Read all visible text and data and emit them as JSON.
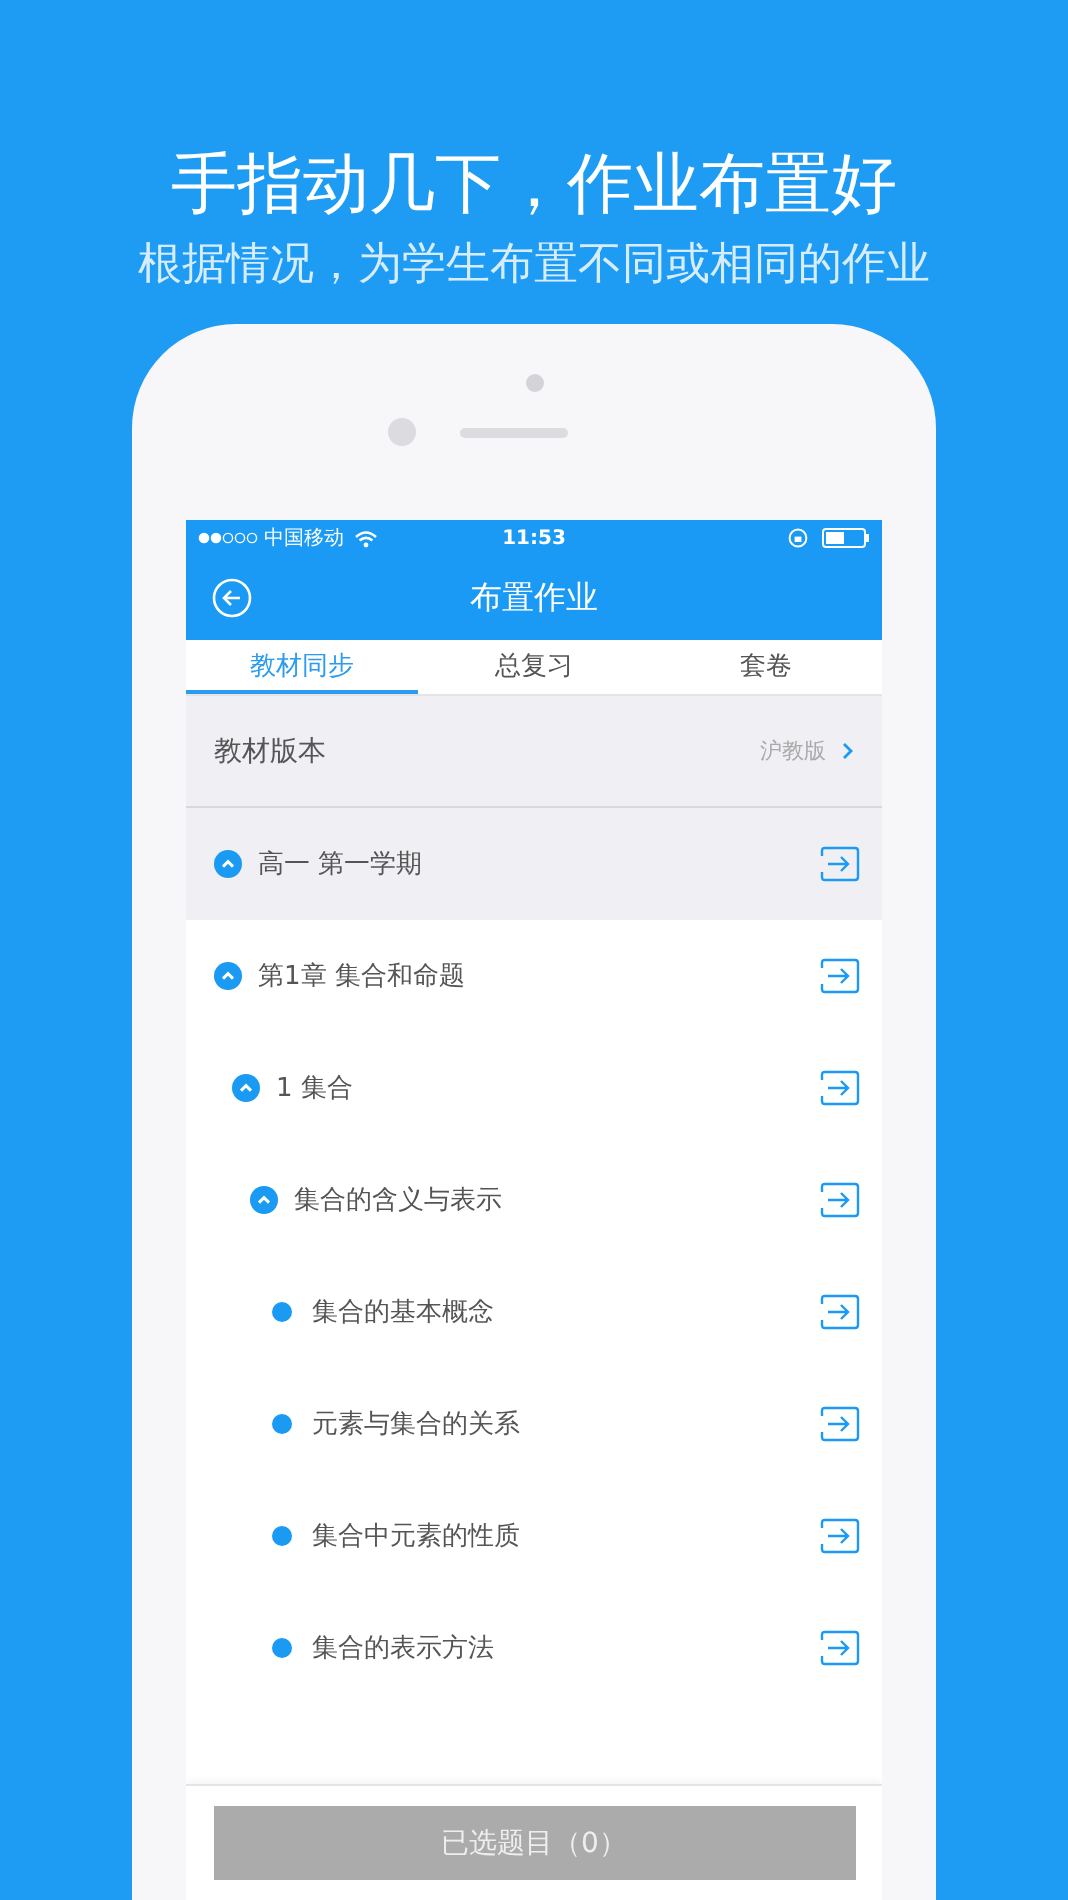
{
  "headline": "手指动几下，作业布置好",
  "subheadline": "根据情况，为学生布置不同或相同的作业",
  "status_bar": {
    "carrier": "中国移动",
    "time": "11:53"
  },
  "nav": {
    "title": "布置作业"
  },
  "tabs": [
    {
      "label": "教材同步",
      "selected": true
    },
    {
      "label": "总复习",
      "selected": false
    },
    {
      "label": "套卷",
      "selected": false
    }
  ],
  "textbook_version": {
    "label": "教材版本",
    "value": "沪教版"
  },
  "tree": [
    {
      "label": "高一 第一学期",
      "expanded": true,
      "selected": true,
      "children": [
        {
          "label": "第1章 集合和命题",
          "expanded": true,
          "selected": false,
          "children": [
            {
              "label": "1 集合",
              "expanded": true,
              "selected": false,
              "children": [
                {
                  "label": "集合的含义与表示",
                  "expanded": true,
                  "selected": false,
                  "children": [
                    {
                      "label": "集合的基本概念",
                      "selected": false
                    },
                    {
                      "label": "元素与集合的关系",
                      "selected": false
                    },
                    {
                      "label": "集合中元素的性质",
                      "selected": false
                    },
                    {
                      "label": "集合的表示方法",
                      "selected": false
                    }
                  ]
                }
              ]
            }
          ]
        }
      ]
    }
  ],
  "bottom_button": "已选题目（0）"
}
